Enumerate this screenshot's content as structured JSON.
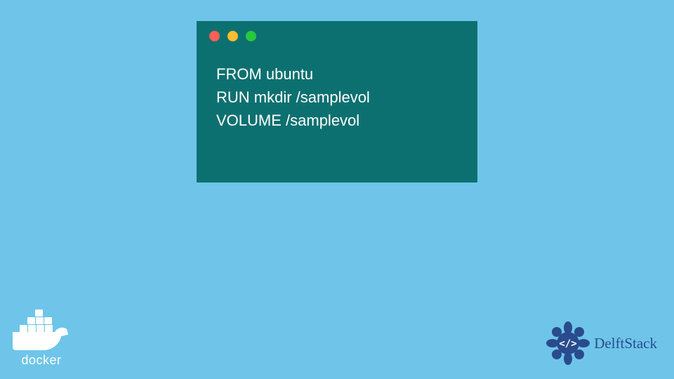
{
  "code": {
    "lines": [
      "FROM ubuntu",
      "RUN mkdir /samplevol",
      "VOLUME /samplevol"
    ]
  },
  "logos": {
    "docker": {
      "label": "docker"
    },
    "delftstack": {
      "badge_text": "</>",
      "label": "DelftStack"
    }
  },
  "colors": {
    "background": "#6ec5e9",
    "code_window": "#0d7070",
    "code_text": "#ffffff",
    "delftstack_primary": "#2a4b8d"
  }
}
